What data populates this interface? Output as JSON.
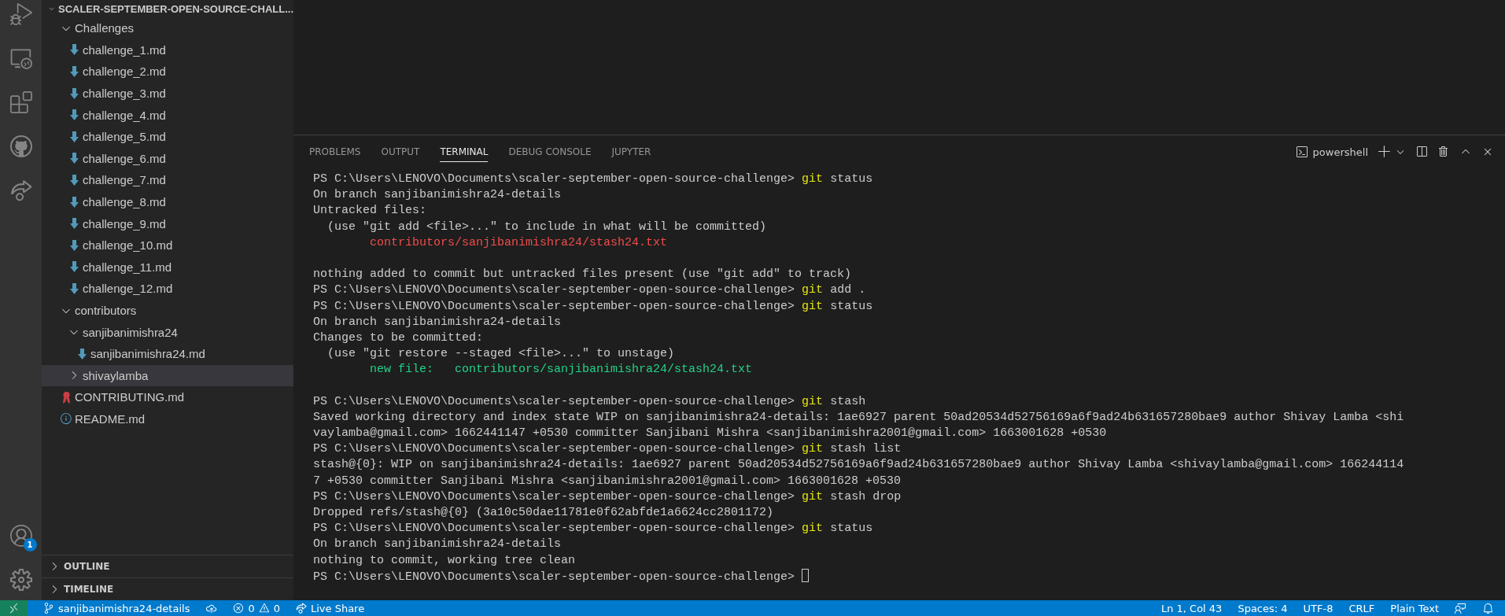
{
  "activity_bar": {
    "account_badge": "1"
  },
  "explorer": {
    "root": {
      "label": "SCALER-SEPTEMBER-OPEN-SOURCE-CHALL...",
      "expanded": true
    },
    "tree": [
      {
        "label": "Challenges",
        "kind": "folder",
        "expanded": true,
        "selected": false,
        "children": [
          {
            "label": "challenge_1.md",
            "kind": "md-file",
            "selected": false
          },
          {
            "label": "challenge_2.md",
            "kind": "md-file",
            "selected": false
          },
          {
            "label": "challenge_3.md",
            "kind": "md-file",
            "selected": false
          },
          {
            "label": "challenge_4.md",
            "kind": "md-file",
            "selected": false
          },
          {
            "label": "challenge_5.md",
            "kind": "md-file",
            "selected": false
          },
          {
            "label": "challenge_6.md",
            "kind": "md-file",
            "selected": false
          },
          {
            "label": "challenge_7.md",
            "kind": "md-file",
            "selected": false
          },
          {
            "label": "challenge_8.md",
            "kind": "md-file",
            "selected": false
          },
          {
            "label": "challenge_9.md",
            "kind": "md-file",
            "selected": false
          },
          {
            "label": "challenge_10.md",
            "kind": "md-file",
            "selected": false
          },
          {
            "label": "challenge_11.md",
            "kind": "md-file",
            "selected": false
          },
          {
            "label": "challenge_12.md",
            "kind": "md-file",
            "selected": false
          }
        ]
      },
      {
        "label": "contributors",
        "kind": "folder",
        "expanded": true,
        "selected": false,
        "children": [
          {
            "label": "sanjibanimishra24",
            "kind": "folder",
            "expanded": true,
            "selected": false,
            "children": [
              {
                "label": "sanjibanimishra24.md",
                "kind": "md-file",
                "selected": false
              }
            ]
          },
          {
            "label": "shivaylamba",
            "kind": "folder",
            "expanded": false,
            "selected": true
          }
        ]
      },
      {
        "label": "CONTRIBUTING.md",
        "kind": "license-file",
        "selected": false
      },
      {
        "label": "README.md",
        "kind": "info-file",
        "selected": false
      }
    ],
    "sections": [
      {
        "label": "OUTLINE",
        "expanded": false
      },
      {
        "label": "TIMELINE",
        "expanded": false
      }
    ]
  },
  "panel": {
    "tabs": [
      {
        "label": "PROBLEMS",
        "selected": false
      },
      {
        "label": "OUTPUT",
        "selected": false
      },
      {
        "label": "TERMINAL",
        "selected": true
      },
      {
        "label": "DEBUG CONSOLE",
        "selected": false
      },
      {
        "label": "JUPYTER",
        "selected": false
      }
    ],
    "shell": "powershell",
    "terminal": [
      {
        "kind": "prompt",
        "prompt": "PS C:\\Users\\LENOVO\\Documents\\scaler-september-open-source-challenge> ",
        "program": "git",
        "args": " status"
      },
      {
        "kind": "output",
        "text": "On branch sanjibanimishra24-details"
      },
      {
        "kind": "output",
        "text": "Untracked files:"
      },
      {
        "kind": "output",
        "text": "  (use \"git add <file>...\" to include in what will be committed)"
      },
      {
        "kind": "untracked",
        "text": "        contributors/sanjibanimishra24/stash24.txt"
      },
      {
        "kind": "blank"
      },
      {
        "kind": "output",
        "text": "nothing added to commit but untracked files present (use \"git add\" to track)"
      },
      {
        "kind": "prompt",
        "prompt": "PS C:\\Users\\LENOVO\\Documents\\scaler-september-open-source-challenge> ",
        "program": "git",
        "args": " add ."
      },
      {
        "kind": "prompt",
        "prompt": "PS C:\\Users\\LENOVO\\Documents\\scaler-september-open-source-challenge> ",
        "program": "git",
        "args": " status"
      },
      {
        "kind": "output",
        "text": "On branch sanjibanimishra24-details"
      },
      {
        "kind": "output",
        "text": "Changes to be committed:"
      },
      {
        "kind": "output",
        "text": "  (use \"git restore --staged <file>...\" to unstage)"
      },
      {
        "kind": "staged",
        "text": "        new file:   contributors/sanjibanimishra24/stash24.txt"
      },
      {
        "kind": "blank"
      },
      {
        "kind": "prompt",
        "prompt": "PS C:\\Users\\LENOVO\\Documents\\scaler-september-open-source-challenge> ",
        "program": "git",
        "args": " stash"
      },
      {
        "kind": "output",
        "text": "Saved working directory and index state WIP on sanjibanimishra24-details: 1ae6927 parent 50ad20534d52756169a6f9ad24b631657280bae9 author Shivay Lamba <shi"
      },
      {
        "kind": "output",
        "text": "vaylamba@gmail.com> 1662441147 +0530 committer Sanjibani Mishra <sanjibanimishra2001@gmail.com> 1663001628 +0530"
      },
      {
        "kind": "prompt",
        "prompt": "PS C:\\Users\\LENOVO\\Documents\\scaler-september-open-source-challenge> ",
        "program": "git",
        "args": " stash list"
      },
      {
        "kind": "output",
        "text": "stash@{0}: WIP on sanjibanimishra24-details: 1ae6927 parent 50ad20534d52756169a6f9ad24b631657280bae9 author Shivay Lamba <shivaylamba@gmail.com> 166244114"
      },
      {
        "kind": "output",
        "text": "7 +0530 committer Sanjibani Mishra <sanjibanimishra2001@gmail.com> 1663001628 +0530"
      },
      {
        "kind": "prompt",
        "prompt": "PS C:\\Users\\LENOVO\\Documents\\scaler-september-open-source-challenge> ",
        "program": "git",
        "args": " stash drop"
      },
      {
        "kind": "output",
        "text": "Dropped refs/stash@{0} (3a10c50dae11781e0f62abfde1a6624cc2801172)"
      },
      {
        "kind": "prompt",
        "prompt": "PS C:\\Users\\LENOVO\\Documents\\scaler-september-open-source-challenge> ",
        "program": "git",
        "args": " status"
      },
      {
        "kind": "output",
        "text": "On branch sanjibanimishra24-details"
      },
      {
        "kind": "output",
        "text": "nothing to commit, working tree clean"
      },
      {
        "kind": "input",
        "prompt": "PS C:\\Users\\LENOVO\\Documents\\scaler-september-open-source-challenge> "
      }
    ]
  },
  "status_bar": {
    "branch": "sanjibanimishra24-details",
    "errors": "0",
    "warnings": "0",
    "live_share": "Live Share",
    "right_items": [
      "Ln 1, Col 43",
      "Spaces: 4",
      "UTF-8",
      "CRLF",
      "Plain Text"
    ]
  }
}
